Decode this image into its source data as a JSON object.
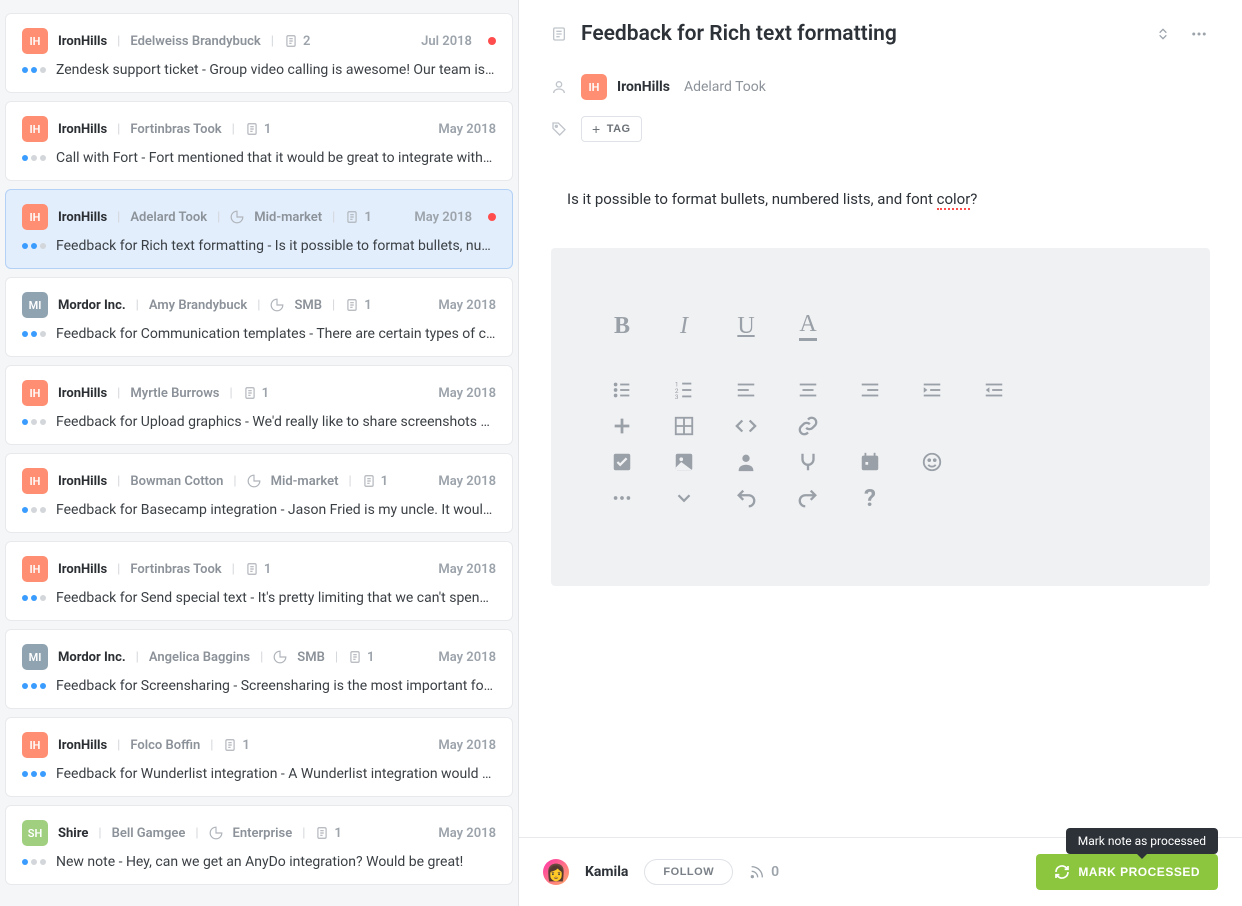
{
  "list": [
    {
      "id": "c1",
      "avClass": "av-ih",
      "avText": "IH",
      "company": "IronHills",
      "person": "Edelweiss Brandybuck",
      "segment": "",
      "docCount": "2",
      "date": "Jul 2018",
      "redDot": true,
      "dots": [
        "d-blue",
        "d-blue",
        "d-grey"
      ],
      "snippet": "Zendesk support ticket - Group video calling is awesome! Our team is…"
    },
    {
      "id": "c2",
      "avClass": "av-ih",
      "avText": "IH",
      "company": "IronHills",
      "person": "Fortinbras Took",
      "segment": "",
      "docCount": "1",
      "date": "May 2018",
      "redDot": false,
      "dots": [
        "d-blue",
        "d-grey",
        "d-grey"
      ],
      "snippet": "Call with Fort - Fort mentioned that it would be great to integrate with…"
    },
    {
      "id": "c3",
      "avClass": "av-ih",
      "avText": "IH",
      "company": "IronHills",
      "person": "Adelard Took",
      "segment": "Mid-market",
      "docCount": "1",
      "date": "May 2018",
      "redDot": true,
      "dots": [
        "d-blue",
        "d-blue",
        "d-grey"
      ],
      "snippet": "Feedback for Rich text formatting - Is it possible to format bullets, nu…",
      "selected": true
    },
    {
      "id": "c4",
      "avClass": "av-mi",
      "avText": "MI",
      "company": "Mordor Inc.",
      "person": "Amy Brandybuck",
      "segment": "SMB",
      "docCount": "1",
      "date": "May 2018",
      "redDot": false,
      "dots": [
        "d-blue",
        "d-blue",
        "d-grey"
      ],
      "snippet": "Feedback for Communication templates - There are certain types of c…"
    },
    {
      "id": "c5",
      "avClass": "av-ih",
      "avText": "IH",
      "company": "IronHills",
      "person": "Myrtle Burrows",
      "segment": "",
      "docCount": "1",
      "date": "May 2018",
      "redDot": false,
      "dots": [
        "d-blue",
        "d-grey",
        "d-grey"
      ],
      "snippet": "Feedback for Upload graphics - We'd really like to share screenshots …"
    },
    {
      "id": "c6",
      "avClass": "av-ih",
      "avText": "IH",
      "company": "IronHills",
      "person": "Bowman Cotton",
      "segment": "Mid-market",
      "docCount": "1",
      "date": "May 2018",
      "redDot": false,
      "dots": [
        "d-blue",
        "d-grey",
        "d-grey"
      ],
      "snippet": "Feedback for Basecamp integration - Jason Fried is my uncle. It woul…"
    },
    {
      "id": "c7",
      "avClass": "av-ih",
      "avText": "IH",
      "company": "IronHills",
      "person": "Fortinbras Took",
      "segment": "",
      "docCount": "1",
      "date": "May 2018",
      "redDot": false,
      "dots": [
        "d-blue",
        "d-blue",
        "d-grey"
      ],
      "snippet": "Feedback for Send special text - It's pretty limiting that we can't spen…"
    },
    {
      "id": "c8",
      "avClass": "av-mi",
      "avText": "MI",
      "company": "Mordor Inc.",
      "person": "Angelica Baggins",
      "segment": "SMB",
      "docCount": "1",
      "date": "May 2018",
      "redDot": false,
      "dots": [
        "d-blue",
        "d-blue",
        "d-blue"
      ],
      "snippet": "Feedback for Screensharing - Screensharing is the most important fo…"
    },
    {
      "id": "c9",
      "avClass": "av-ih",
      "avText": "IH",
      "company": "IronHills",
      "person": "Folco Boffin",
      "segment": "",
      "docCount": "1",
      "date": "May 2018",
      "redDot": false,
      "dots": [
        "d-blue",
        "d-blue",
        "d-blue"
      ],
      "snippet": "Feedback for Wunderlist integration - A Wunderlist integration would …"
    },
    {
      "id": "c10",
      "avClass": "av-sh",
      "avText": "SH",
      "company": "Shire",
      "person": "Bell Gamgee",
      "segment": "Enterprise",
      "docCount": "1",
      "date": "May 2018",
      "redDot": false,
      "dots": [
        "d-blue",
        "d-grey",
        "d-grey"
      ],
      "snippet": "New note - Hey, can we get an AnyDo integration? Would be great!"
    }
  ],
  "detail": {
    "title": "Feedback for Rich text formatting",
    "avText": "IH",
    "company": "IronHills",
    "person": "Adelard Took",
    "tagLabel": "TAG",
    "bodyPrefix": "Is it possible to format bullets, numbered lists, and font ",
    "bodyErr": "color",
    "bodySuffix": "?",
    "currentUser": "Kamila",
    "followLabel": "FOLLOW",
    "followerCount": "0",
    "markLabel": "MARK PROCESSED",
    "tooltip": "Mark note as processed",
    "toolbar": {
      "row1": [
        "bold",
        "italic",
        "underline",
        "text-color"
      ],
      "row2": [
        "bullet-list",
        "number-list",
        "align-left",
        "align-center",
        "align-right",
        "indent",
        "outdent"
      ],
      "row3": [
        "insert",
        "table",
        "code",
        "link",
        "",
        "",
        ""
      ],
      "row4": [
        "checkbox",
        "image",
        "mention",
        "fork",
        "calendar",
        "emoji",
        ""
      ],
      "row5": [
        "more",
        "expand",
        "undo",
        "redo",
        "help",
        "",
        ""
      ]
    }
  }
}
